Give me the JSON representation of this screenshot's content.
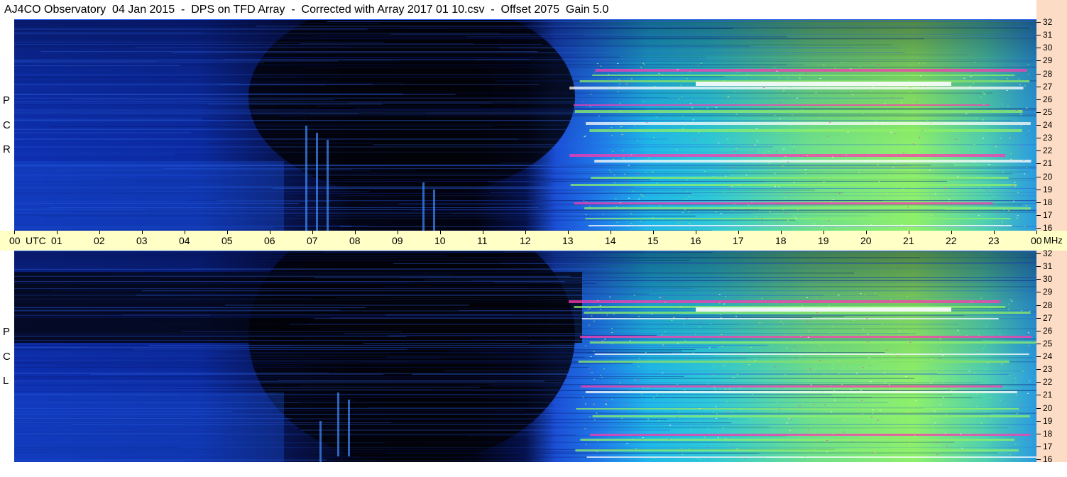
{
  "title": "AJ4CO Observatory  04 Jan 2015  -  DPS on TFD Array  -  Corrected with Array 2017 01 10.csv  -  Offset 2075  Gain 5.0",
  "chart_data": {
    "type": "heatmap",
    "x_axis": {
      "unit_label": "UTC",
      "tick_labels": [
        "00",
        "01",
        "02",
        "03",
        "04",
        "05",
        "06",
        "07",
        "08",
        "09",
        "10",
        "11",
        "12",
        "13",
        "14",
        "15",
        "16",
        "17",
        "18",
        "19",
        "20",
        "21",
        "22",
        "23",
        "00"
      ]
    },
    "y_axis": {
      "unit_label": "MHz",
      "tick_labels": [
        "32",
        "31",
        "30",
        "29",
        "28",
        "27",
        "26",
        "25",
        "24",
        "23",
        "22",
        "21",
        "20",
        "19",
        "18",
        "17",
        "16"
      ]
    },
    "panels": [
      {
        "name": "R C P",
        "letters": [
          "P",
          "C",
          "R"
        ]
      },
      {
        "name": "L C P",
        "letters": [
          "P",
          "C",
          "L"
        ]
      }
    ],
    "colors": {
      "background_dark": "#050512",
      "low_blue": "#1a4fd6",
      "mid_cyan": "#1fb8e8",
      "high_green": "#8ef06a",
      "peak_magenta": "#ff3ab0",
      "saturated_white": "#ffffff",
      "axis_band": "#ffffc6",
      "mhz_band": "#fcdcc4"
    }
  }
}
